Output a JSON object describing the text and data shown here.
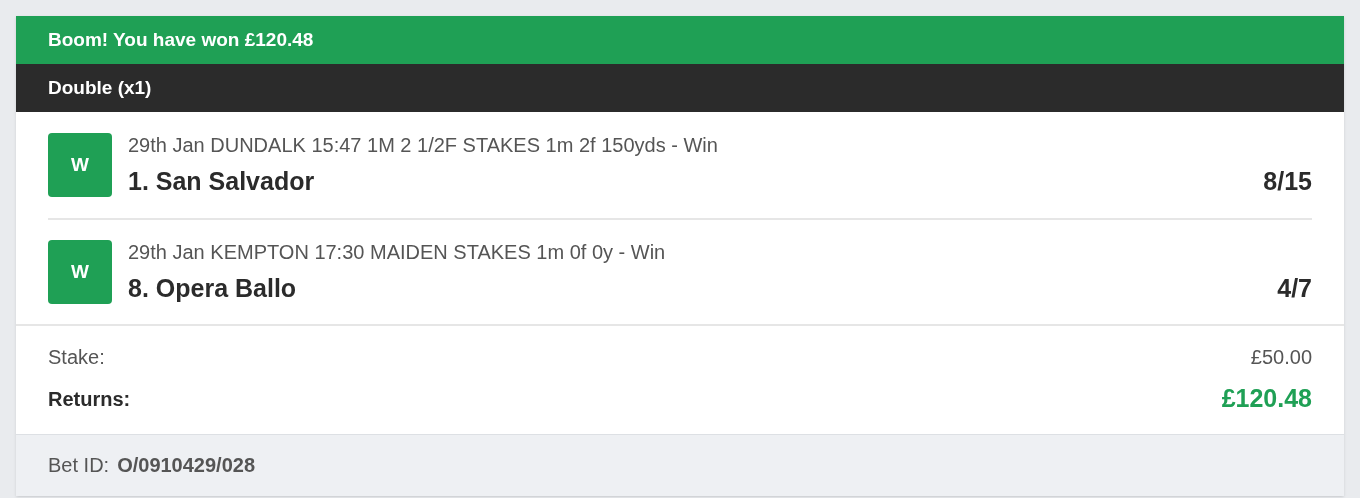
{
  "banner": {
    "text": "Boom! You have won £120.48"
  },
  "bet_type": "Double (x1)",
  "legs": [
    {
      "badge": "W",
      "event": "29th Jan DUNDALK 15:47 1M 2 1/2F STAKES 1m 2f 150yds - Win",
      "selection": "1. San Salvador",
      "odds": "8/15"
    },
    {
      "badge": "W",
      "event": "29th Jan KEMPTON 17:30 MAIDEN STAKES 1m 0f 0y - Win",
      "selection": "8. Opera Ballo",
      "odds": "4/7"
    }
  ],
  "stake": {
    "label": "Stake:",
    "value": "£50.00"
  },
  "returns": {
    "label": "Returns:",
    "value": "£120.48"
  },
  "bet_id": {
    "label": "Bet ID:",
    "value": "O/0910429/028"
  }
}
